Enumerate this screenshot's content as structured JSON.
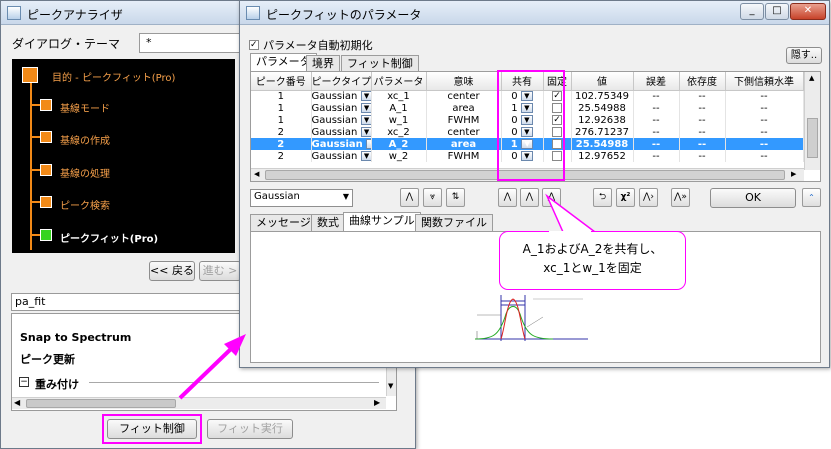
{
  "analyzer": {
    "title": "ピークアナライザ",
    "theme_label": "ダイアログ・テーマ",
    "theme_value": "*",
    "tree": [
      {
        "label": "目的 - ピークフィット(Pro)"
      },
      {
        "label": "基線モード"
      },
      {
        "label": "基線の作成"
      },
      {
        "label": "基線の処理"
      },
      {
        "label": "ピーク検索"
      },
      {
        "label": "ピークフィット(Pro)"
      }
    ],
    "back_label": "<< 戻る",
    "next_label": "進む >",
    "pa_fit_value": "pa_fit",
    "snap_label": "Snap to Spectrum",
    "peak_update_label": "ピーク更新",
    "weight_label": "重み付け",
    "fit_control_label": "フィット制御",
    "fit_run_label": "フィット実行"
  },
  "params": {
    "title": "ピークフィットのパラメータ",
    "auto_init_label": "パラメータ自動初期化",
    "hide_label": "隠す..",
    "tabs": [
      "パラメータ",
      "境界",
      "フィット制御"
    ],
    "columns": [
      "ピーク番号",
      "ピークタイプ",
      "パラメータ",
      "意味",
      "共有",
      "固定",
      "値",
      "誤差",
      "依存度",
      "下側信頼水準"
    ],
    "rows": [
      {
        "peak": "1",
        "type": "Gaussian",
        "param": "xc_1",
        "meaning": "center",
        "share": "0",
        "fixed": true,
        "value": "102.75349",
        "err": "--",
        "dep": "--",
        "lcl": "--"
      },
      {
        "peak": "1",
        "type": "Gaussian",
        "param": "A_1",
        "meaning": "area",
        "share": "1",
        "fixed": false,
        "value": "25.54988",
        "err": "--",
        "dep": "--",
        "lcl": "--"
      },
      {
        "peak": "1",
        "type": "Gaussian",
        "param": "w_1",
        "meaning": "FWHM",
        "share": "0",
        "fixed": true,
        "value": "12.92638",
        "err": "--",
        "dep": "--",
        "lcl": "--"
      },
      {
        "peak": "2",
        "type": "Gaussian",
        "param": "xc_2",
        "meaning": "center",
        "share": "0",
        "fixed": false,
        "value": "276.71237",
        "err": "--",
        "dep": "--",
        "lcl": "--"
      },
      {
        "peak": "2",
        "type": "Gaussian",
        "param": "A_2",
        "meaning": "area",
        "share": "1",
        "fixed": false,
        "value": "25.54988",
        "err": "--",
        "dep": "--",
        "lcl": "--"
      },
      {
        "peak": "2",
        "type": "Gaussian",
        "param": "w_2",
        "meaning": "FWHM",
        "share": "0",
        "fixed": false,
        "value": "12.97652",
        "err": "--",
        "dep": "--",
        "lcl": "--"
      }
    ],
    "peak_type_value": "Gaussian",
    "ok_label": "OK",
    "lower_tabs": [
      "メッセージ",
      "数式",
      "曲線サンプル",
      "関数ファイル"
    ]
  },
  "callout": {
    "line1": "A_1およびA_2を共有し、",
    "line2": "xc_1とw_1を固定"
  },
  "colors": {
    "accent": "#ff00ff",
    "selection": "#3399ff",
    "tree_orange": "#f28a18",
    "tree_green": "#35d41f"
  }
}
